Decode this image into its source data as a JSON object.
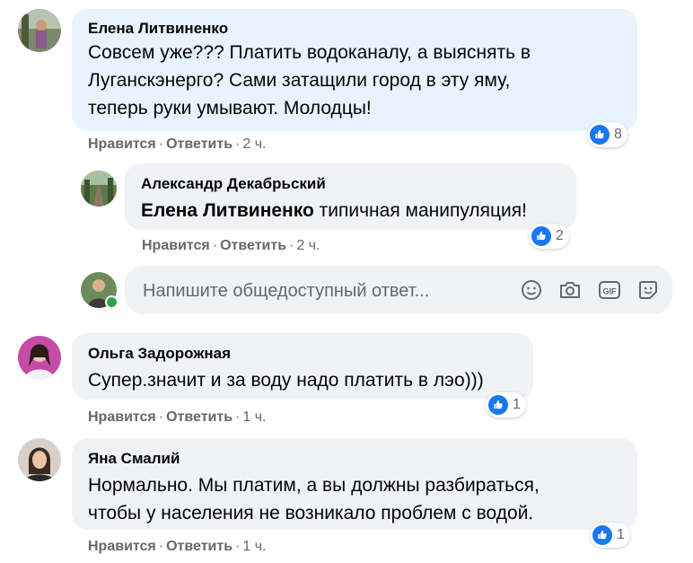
{
  "comments": [
    {
      "author": "Елена Литвиненко",
      "lines": [
        "Совсем уже??? Платить водоканалу, а выяснять в",
        "Луганскэнерго? Сами затащили город в эту яму,",
        "теперь руки умывают. Молодцы!"
      ],
      "like": "Нравится",
      "reply": "Ответить",
      "time": "2 ч.",
      "reactions": "8"
    },
    {
      "author": "Александр Декабрьский",
      "mention": "Елена Литвиненко",
      "text": " типичная манипуляция!",
      "like": "Нравится",
      "reply": "Ответить",
      "time": "2 ч.",
      "reactions": "2"
    },
    {
      "author": "Ольга Задорожная",
      "lines": [
        "Супер.значит и за воду надо платить в лэо)))"
      ],
      "like": "Нравится",
      "reply": "Ответить",
      "time": "1 ч.",
      "reactions": "1"
    },
    {
      "author": "Яна Смалий",
      "lines": [
        "Нормально. Мы платим, а вы должны разбираться,",
        "чтобы у населения не возникало проблем с водой."
      ],
      "like": "Нравится",
      "reply": "Ответить",
      "time": "1 ч.",
      "reactions": "1"
    }
  ],
  "reply_box": {
    "placeholder": "Напишите общедоступный ответ..."
  },
  "icons": {
    "like": "thumbs-up-icon",
    "tools": [
      "emoji-icon",
      "camera-icon",
      "gif-icon",
      "sticker-icon"
    ]
  },
  "colors": {
    "accent": "#1877f2",
    "bubble": "#f0f2f5",
    "highlight_bubble": "#e7f3ff",
    "secondary_text": "#65676b",
    "online": "#31a24c"
  }
}
